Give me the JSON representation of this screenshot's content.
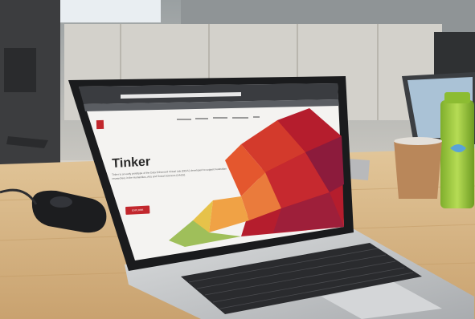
{
  "screen": {
    "title": "Tinker",
    "description": "Tinker is an early prototype of the Data Enhanced Virtual Lab (DEVL) developed to support Australian researchers in the Humanities, Arts and Social Sciences (HASS).",
    "button_label": "EXPLORE"
  },
  "colors": {
    "accent_red": "#c2272d",
    "desk_wood": "#d9b98a",
    "laptop_silver": "#c9cbcd"
  }
}
